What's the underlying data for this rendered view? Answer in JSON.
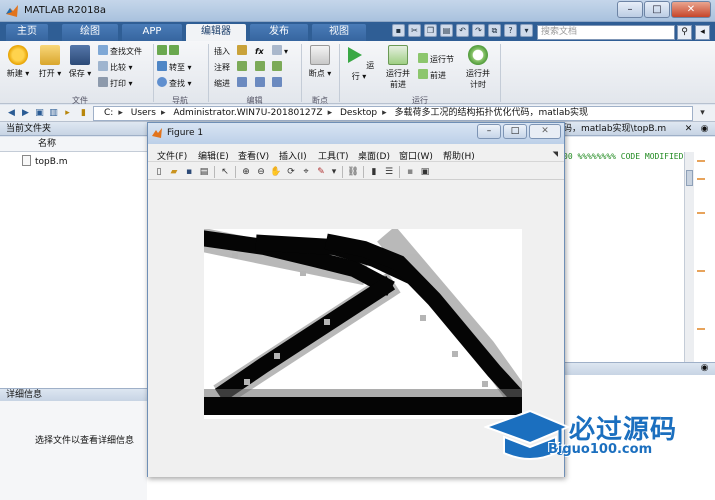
{
  "window": {
    "title": "MATLAB R2018a"
  },
  "tabs": [
    "主页",
    "绘图",
    "APP",
    "编辑器",
    "发布",
    "视图"
  ],
  "search": {
    "placeholder": "搜索文档"
  },
  "toolstrip": {
    "file": {
      "new": "新建",
      "open": "打开",
      "save": "保存",
      "find_files": "查找文件",
      "compare": "比较",
      "print": "打印",
      "group": "文件"
    },
    "navigate": {
      "goto": "转至",
      "find": "查找",
      "group": "导航"
    },
    "edit": {
      "insert": "插入",
      "comment": "注释",
      "indent": "缩进",
      "fx": "fx",
      "group": "编辑"
    },
    "breakpoints": {
      "label": "断点",
      "group": "断点"
    },
    "run": {
      "run": "运行",
      "run_advance_1": "运行并",
      "run_advance_2": "前进",
      "run_section": "运行节",
      "advance": "前进",
      "run_time_1": "运行并",
      "run_time_2": "计时",
      "group": "运行"
    }
  },
  "address": {
    "segments": [
      "C:",
      "Users",
      "Administrator.WIN7U-20180127Z",
      "Desktop",
      "多载荷多工况的结构拓扑优化代码，matlab实现"
    ]
  },
  "current_folder": {
    "header": "当前文件夹",
    "column": "名称",
    "files": [
      "topB.m"
    ]
  },
  "details": {
    "header": "详细信息",
    "empty_text": "选择文件以查看详细信息"
  },
  "editor": {
    "title": "码，matlab实现\\topB.m",
    "code_line": "00 %%%%%%%% CODE MODIFIED"
  },
  "figure": {
    "title": "Figure 1",
    "menus": [
      "文件(F)",
      "编辑(E)",
      "查看(V)",
      "插入(I)",
      "工具(T)",
      "桌面(D)",
      "窗口(W)",
      "帮助(H)"
    ]
  },
  "watermark": {
    "text": "必过源码",
    "sub": "Biguo100.com"
  },
  "colors": {
    "accent": "#2f5e95",
    "watermark": "#1b6fbf",
    "code_comment": "#228b22"
  }
}
